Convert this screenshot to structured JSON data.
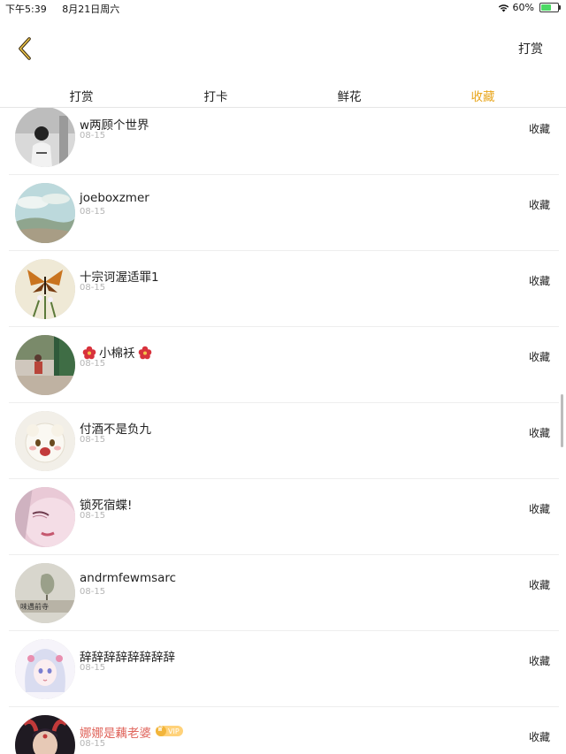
{
  "status_bar": {
    "time": "下午5:39",
    "date": "8月21日周六",
    "battery": "60%",
    "battery_level": 0.6
  },
  "nav": {
    "right_button": "打赏"
  },
  "tabs": [
    {
      "label": "打赏",
      "active": false
    },
    {
      "label": "打卡",
      "active": false
    },
    {
      "label": "鲜花",
      "active": false
    },
    {
      "label": "收藏",
      "active": true
    }
  ],
  "colors": {
    "active_tab": "#e8a51b",
    "vip_name": "#e0665d"
  },
  "list": [
    {
      "name": "w两顾个世界",
      "date": "08-15",
      "action": "收藏",
      "avatar": "person-bw"
    },
    {
      "name": "joeboxzmer",
      "date": "08-15",
      "action": "收藏",
      "avatar": "sky-landscape"
    },
    {
      "name": "十宗诃渥适罪1",
      "date": "08-15",
      "action": "收藏",
      "avatar": "butterfly-flower"
    },
    {
      "name_prefix_icon": "flower-icon",
      "name": "小棉袄",
      "name_suffix_icon": "flower-icon",
      "date": "08-15",
      "action": "收藏",
      "avatar": "street-photo"
    },
    {
      "name": "付酒不是负九",
      "date": "08-15",
      "action": "收藏",
      "avatar": "cartoon-sheep"
    },
    {
      "name": "锁死宿蝶!",
      "date": "08-15",
      "action": "收藏",
      "avatar": "pink-face"
    },
    {
      "name": "andrmfewmsarc",
      "date": "08-15",
      "action": "收藏",
      "avatar": "text-photo",
      "avatar_text": "味遇前寺"
    },
    {
      "name": "辞辞辞辞辞辞辞辞",
      "date": "08-15",
      "action": "收藏",
      "avatar": "anime-girl"
    },
    {
      "name": "娜娜是藕老婆",
      "vip": "VIP",
      "date": "08-15",
      "action": "收藏",
      "avatar": "dark-portrait"
    }
  ]
}
